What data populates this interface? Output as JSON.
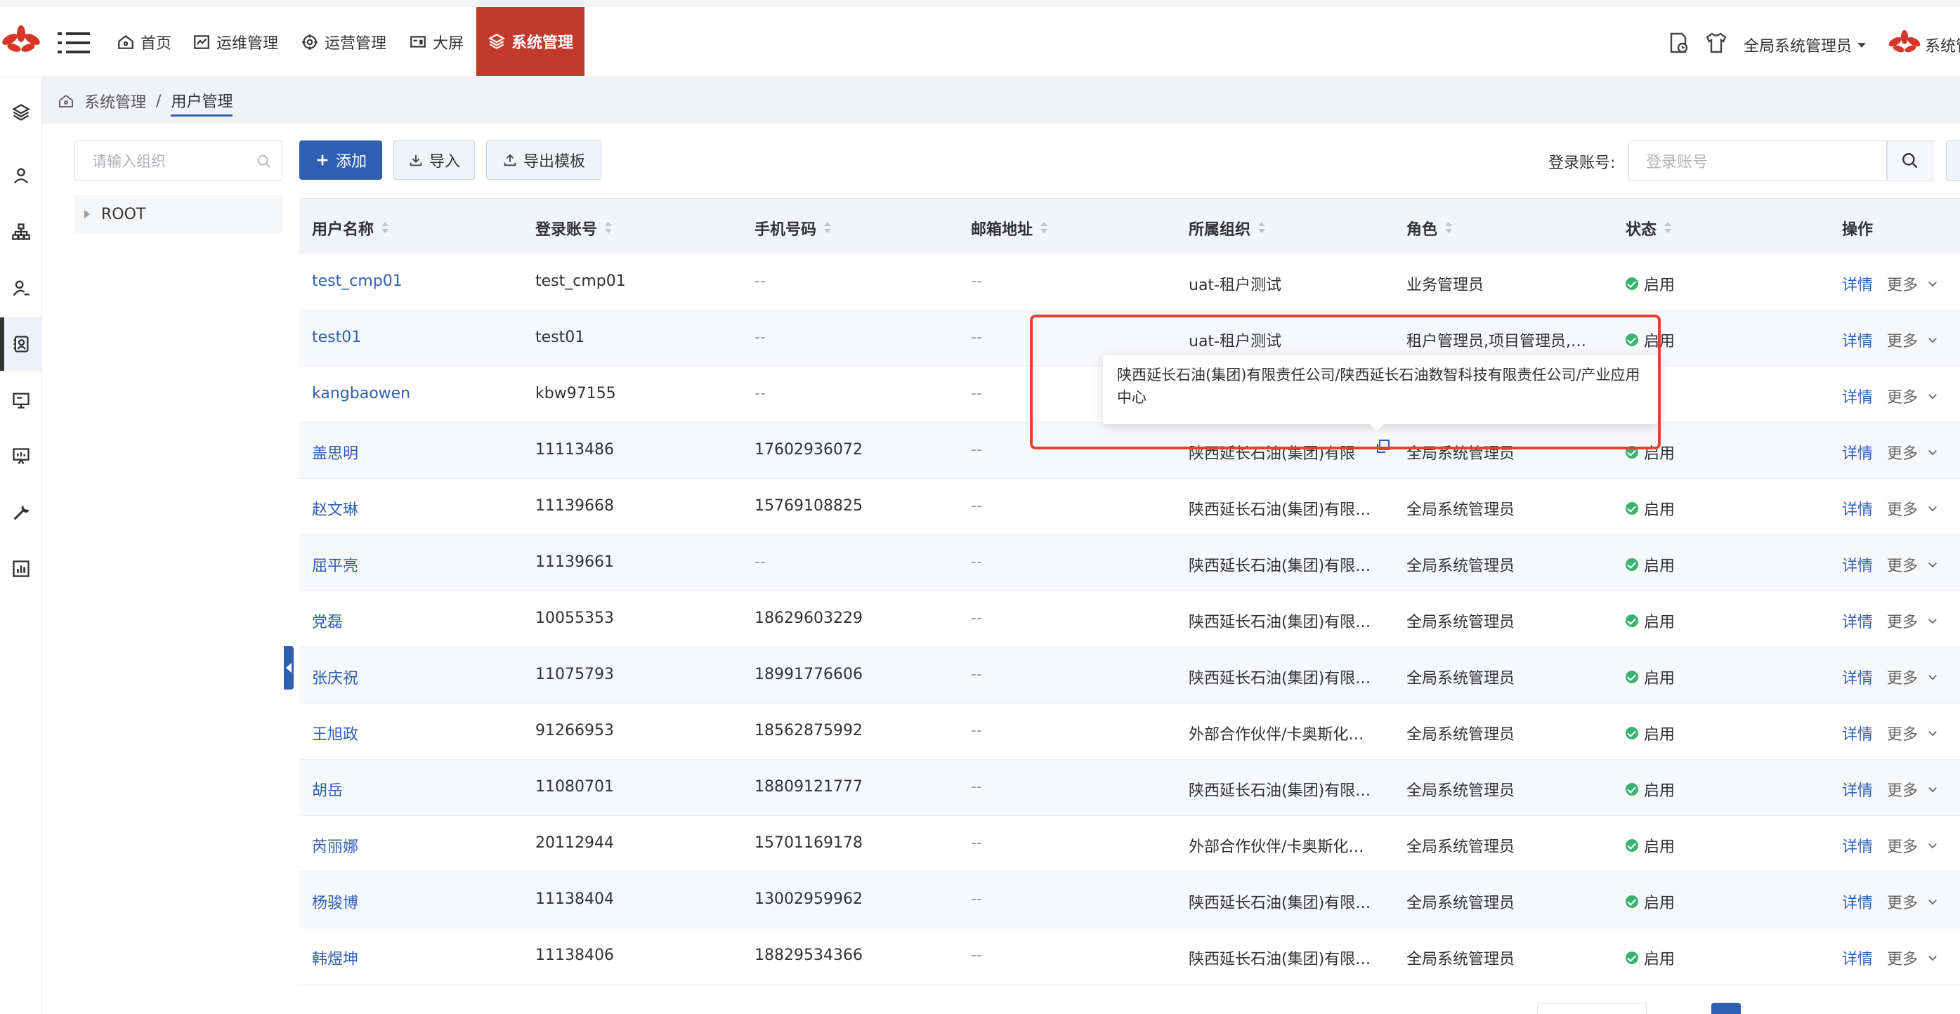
{
  "nav": {
    "items": [
      {
        "label": "首页",
        "icon": "home-icon"
      },
      {
        "label": "运维管理",
        "icon": "chart-line-icon"
      },
      {
        "label": "运营管理",
        "icon": "operations-icon"
      },
      {
        "label": "大屏",
        "icon": "screen-icon"
      }
    ],
    "active": {
      "label": "系统管理",
      "icon": "layers-icon"
    },
    "user_role": "全局系统管理员",
    "user_name": "系统管"
  },
  "breadcrumb": {
    "parent": "系统管理",
    "separator": "/",
    "current": "用户管理"
  },
  "org_tree": {
    "search_placeholder": "请输入组织",
    "root": "ROOT"
  },
  "toolbar": {
    "add_label": "添加",
    "import_label": "导入",
    "export_label": "导出模板",
    "search_label": "登录账号:",
    "search_placeholder": "登录账号"
  },
  "table": {
    "columns": [
      "用户名称",
      "登录账号",
      "手机号码",
      "邮箱地址",
      "所属组织",
      "角色",
      "状态",
      "操作"
    ],
    "rows": [
      {
        "name": "test_cmp01",
        "account": "test_cmp01",
        "phone": "--",
        "email": "--",
        "org": "uat-租户测试",
        "role": "业务管理员",
        "status": "启用"
      },
      {
        "name": "test01",
        "account": "test01",
        "phone": "--",
        "email": "--",
        "org": "uat-租户测试",
        "role": "租户管理员,项目管理员,…",
        "status": "启用"
      },
      {
        "name": "kangbaowen",
        "account": "kbw97155",
        "phone": "--",
        "email": "--",
        "org": "",
        "role": "",
        "status": ""
      },
      {
        "name": "盖思明",
        "account": "11113486",
        "phone": "17602936072",
        "email": "--",
        "org": "陕西延长石油(集团)有限",
        "role": "全局系统管理员",
        "status": "启用"
      },
      {
        "name": "赵文琳",
        "account": "11139668",
        "phone": "15769108825",
        "email": "--",
        "org": "陕西延长石油(集团)有限…",
        "role": "全局系统管理员",
        "status": "启用"
      },
      {
        "name": "屈平亮",
        "account": "11139661",
        "phone": "--",
        "email": "--",
        "org": "陕西延长石油(集团)有限…",
        "role": "全局系统管理员",
        "status": "启用"
      },
      {
        "name": "党磊",
        "account": "10055353",
        "phone": "18629603229",
        "email": "--",
        "org": "陕西延长石油(集团)有限…",
        "role": "全局系统管理员",
        "status": "启用"
      },
      {
        "name": "张庆祝",
        "account": "11075793",
        "phone": "18991776606",
        "email": "--",
        "org": "陕西延长石油(集团)有限…",
        "role": "全局系统管理员",
        "status": "启用"
      },
      {
        "name": "王旭政",
        "account": "91266953",
        "phone": "18562875992",
        "email": "--",
        "org": "外部合作伙伴/卡奥斯化…",
        "role": "全局系统管理员",
        "status": "启用"
      },
      {
        "name": "胡岳",
        "account": "11080701",
        "phone": "18809121777",
        "email": "--",
        "org": "陕西延长石油(集团)有限…",
        "role": "全局系统管理员",
        "status": "启用"
      },
      {
        "name": "芮丽娜",
        "account": "20112944",
        "phone": "15701169178",
        "email": "--",
        "org": "外部合作伙伴/卡奥斯化…",
        "role": "全局系统管理员",
        "status": "启用"
      },
      {
        "name": "杨骏博",
        "account": "11138404",
        "phone": "13002959962",
        "email": "--",
        "org": "陕西延长石油(集团)有限…",
        "role": "全局系统管理员",
        "status": "启用"
      },
      {
        "name": "韩煜坤",
        "account": "11138406",
        "phone": "18829534366",
        "email": "--",
        "org": "陕西延长石油(集团)有限…",
        "role": "全局系统管理员",
        "status": "启用"
      }
    ],
    "op_detail": "详情",
    "op_more": "更多"
  },
  "tooltip": {
    "text": "陕西延长石油(集团)有限责任公司/陕西延长石油数智科技有限责任公司/产业应用中心"
  },
  "colors": {
    "brand_red": "#c23a2c",
    "primary_blue": "#2f5fb3",
    "status_green": "#3bb273",
    "highlight_red": "#e0442e"
  }
}
